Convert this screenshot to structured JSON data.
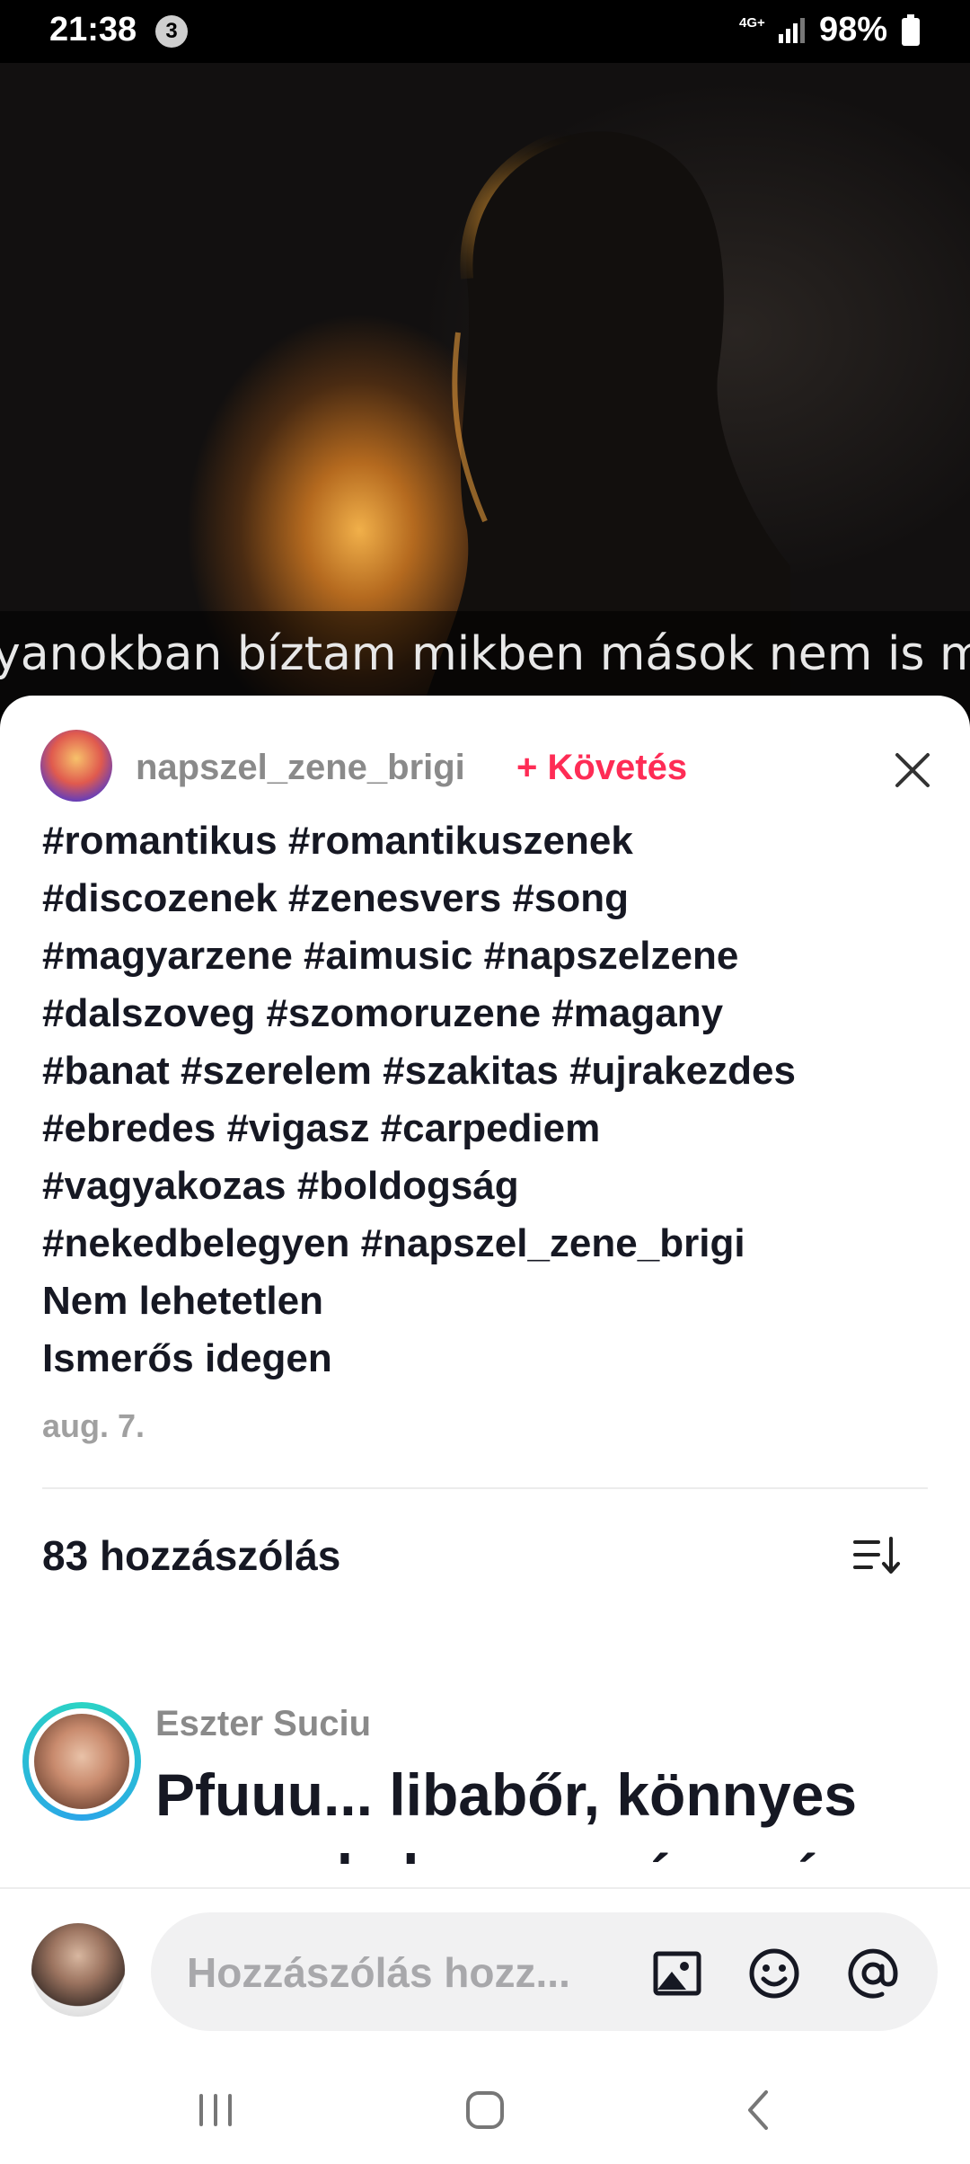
{
  "status_bar": {
    "time": "21:38",
    "notification_count": "3",
    "network": "4G+",
    "battery": "98%"
  },
  "video": {
    "subtitle": "yanokban bíztam mikben mások nem is merne"
  },
  "post": {
    "author": "napszel_zene_brigi",
    "follow_label": "+ Követés",
    "description_lines": [
      "#romantikus #romantikuszenek",
      "#discozenek #zenesvers #song",
      "#magyarzene #aimusic #napszelzene",
      "#dalszoveg #szomoruzene #magany",
      "#banat #szerelem #szakitas #ujrakezdes",
      "#ebredes #vigasz #carpediem",
      "#vagyakozas #boldogság",
      "#nekedbelegyen #napszel_zene_brigi",
      "Nem lehetetlen",
      "Ismerős idegen"
    ],
    "date": "aug. 7."
  },
  "comments": {
    "header": "83 hozzászólás",
    "items": [
      {
        "author": "Eszter Suciu",
        "text": "Pfuuu... libabőr, könnyes szemek, heves szívverés ... minden van"
      }
    ]
  },
  "comment_input": {
    "placeholder": "Hozzászólás hozz..."
  },
  "icons": {
    "close": "close-icon",
    "sort": "sort-icon",
    "image": "image-icon",
    "emoji": "emoji-icon",
    "mention": "at-icon",
    "nav_recents": "recents-icon",
    "nav_home": "home-icon",
    "nav_back": "back-icon"
  },
  "colors": {
    "accent": "#fe2c55",
    "text": "#161823",
    "muted": "#8a8a8a"
  }
}
